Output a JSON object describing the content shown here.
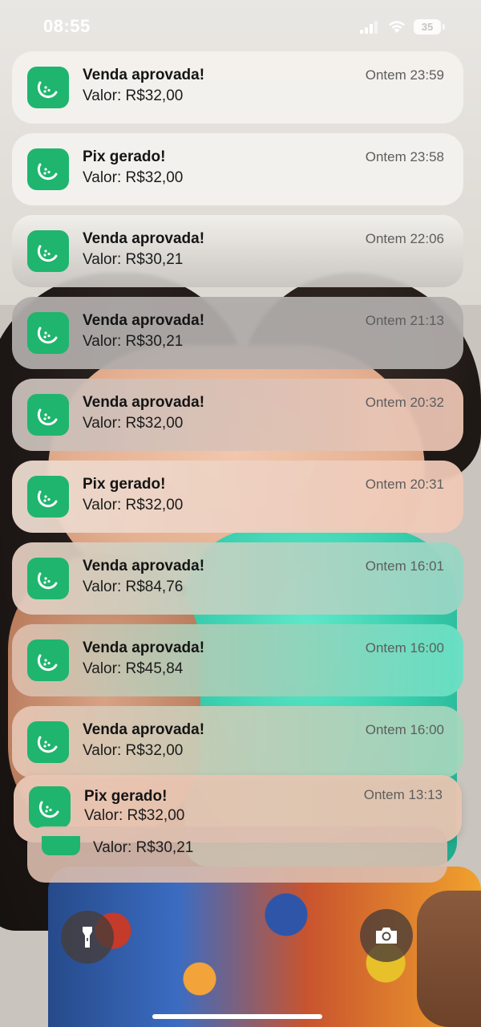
{
  "status_bar": {
    "time": "08:55",
    "battery": "35"
  },
  "notifications": [
    {
      "title": "Venda aprovada!",
      "body": "Valor: R$32,00",
      "time": "Ontem 23:59"
    },
    {
      "title": "Pix gerado!",
      "body": "Valor: R$32,00",
      "time": "Ontem 23:58"
    },
    {
      "title": "Venda aprovada!",
      "body": "Valor: R$30,21",
      "time": "Ontem 22:06"
    },
    {
      "title": "Venda aprovada!",
      "body": "Valor: R$30,21",
      "time": "Ontem 21:13"
    },
    {
      "title": "Venda aprovada!",
      "body": "Valor: R$32,00",
      "time": "Ontem 20:32"
    },
    {
      "title": "Pix gerado!",
      "body": "Valor: R$32,00",
      "time": "Ontem 20:31"
    },
    {
      "title": "Venda aprovada!",
      "body": "Valor: R$84,76",
      "time": "Ontem 16:01"
    },
    {
      "title": "Venda aprovada!",
      "body": "Valor: R$45,84",
      "time": "Ontem 16:00"
    },
    {
      "title": "Venda aprovada!",
      "body": "Valor: R$32,00",
      "time": "Ontem 16:00"
    },
    {
      "title": "Pix gerado!",
      "body": "Valor: R$32,00",
      "time": "Ontem 13:13"
    }
  ],
  "stack_peek": {
    "body": "Valor: R$30,21"
  },
  "app_icon": {
    "name": "melon-slice-icon",
    "color": "#1fb56e"
  },
  "buttons": {
    "flashlight_icon": "flashlight-icon",
    "camera_icon": "camera-icon"
  }
}
